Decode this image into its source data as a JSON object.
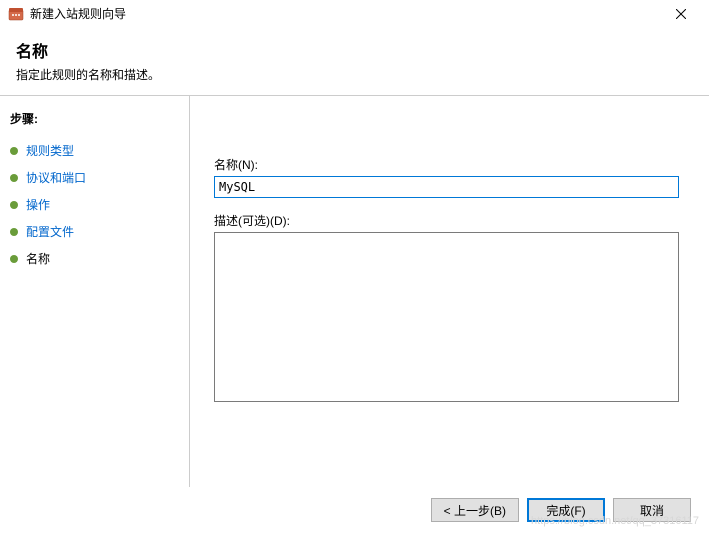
{
  "window": {
    "title": "新建入站规则向导"
  },
  "header": {
    "title": "名称",
    "subtitle": "指定此规则的名称和描述。"
  },
  "sidebar": {
    "steps_label": "步骤:",
    "items": [
      {
        "label": "规则类型",
        "current": false
      },
      {
        "label": "协议和端口",
        "current": false
      },
      {
        "label": "操作",
        "current": false
      },
      {
        "label": "配置文件",
        "current": false
      },
      {
        "label": "名称",
        "current": true
      }
    ]
  },
  "form": {
    "name_label": "名称(N):",
    "name_value": "MySQL",
    "desc_label": "描述(可选)(D):",
    "desc_value": ""
  },
  "footer": {
    "back": "< 上一步(B)",
    "finish": "完成(F)",
    "cancel": "取消"
  },
  "watermark": "https://blog.csdn.net/qq_37316117"
}
